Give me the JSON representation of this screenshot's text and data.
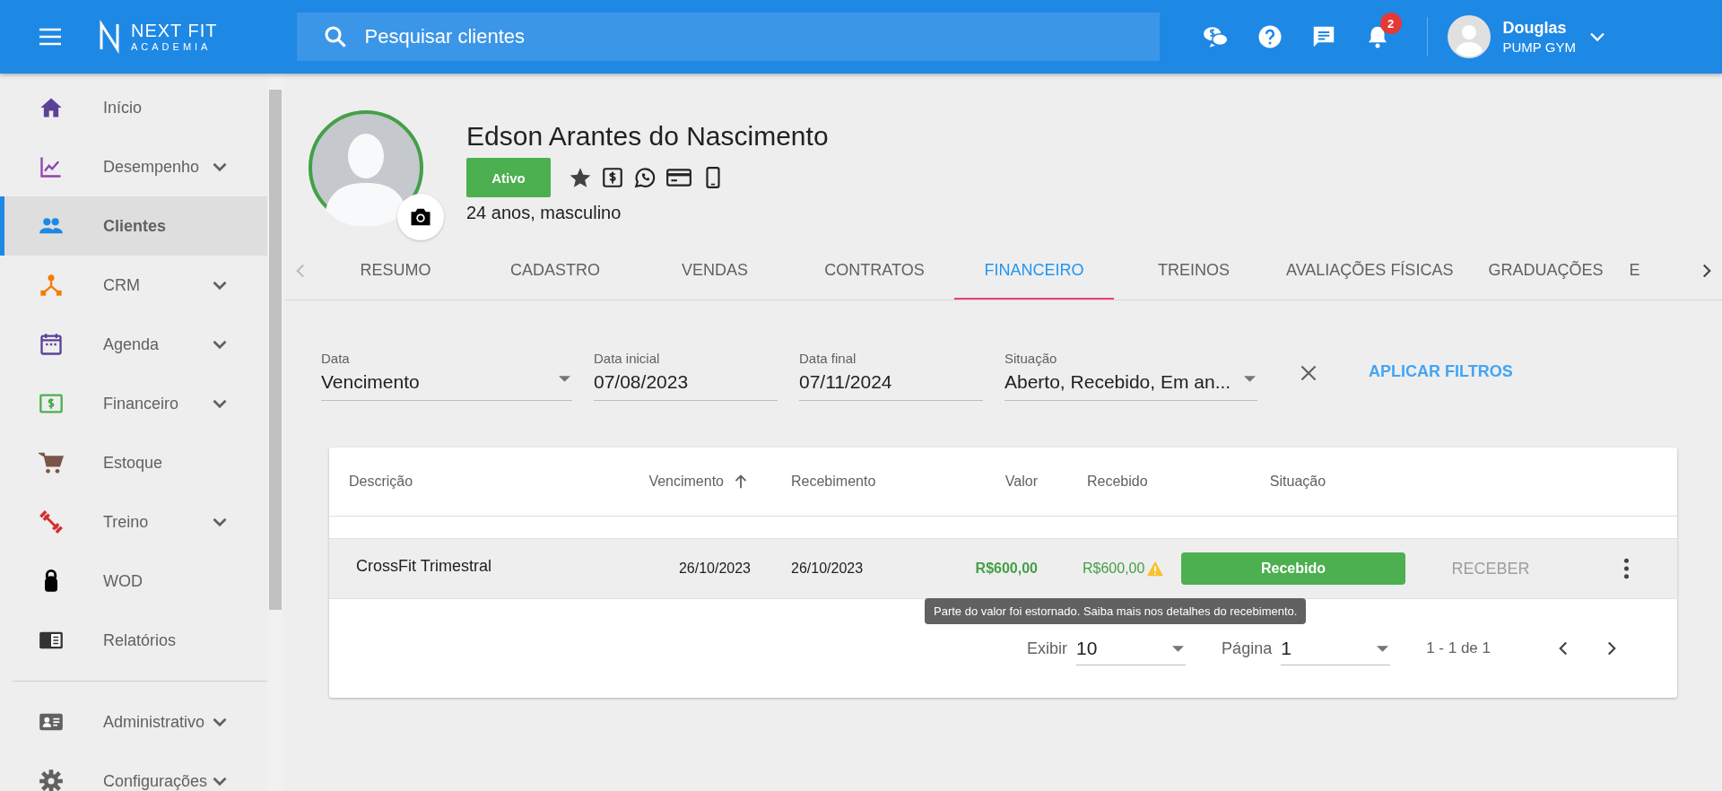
{
  "topbar": {
    "brand": "NEXT FIT",
    "brand_sub": "ACADEMIA",
    "search": {
      "placeholder": "Pesquisar clientes"
    },
    "notifications": "2",
    "user": {
      "name": "Douglas",
      "gym": "PUMP GYM"
    }
  },
  "sidebar": {
    "groups": [
      [
        {
          "label": "Início",
          "expandable": false,
          "selected": false
        },
        {
          "label": "Desempenho",
          "expandable": true,
          "selected": false
        },
        {
          "label": "Clientes",
          "expandable": false,
          "selected": true
        },
        {
          "label": "CRM",
          "expandable": true,
          "selected": false
        },
        {
          "label": "Agenda",
          "expandable": true,
          "selected": false
        },
        {
          "label": "Financeiro",
          "expandable": true,
          "selected": false
        },
        {
          "label": "Estoque",
          "expandable": false,
          "selected": false
        },
        {
          "label": "Treino",
          "expandable": true,
          "selected": false
        },
        {
          "label": "WOD",
          "expandable": false,
          "selected": false
        },
        {
          "label": "Relatórios",
          "expandable": false,
          "selected": false
        }
      ],
      [
        {
          "label": "Administrativo",
          "expandable": true,
          "selected": false
        },
        {
          "label": "Configurações",
          "expandable": true,
          "selected": false
        }
      ]
    ]
  },
  "profile": {
    "name": "Edson Arantes do Nascimento",
    "status": "Ativo",
    "details": "24 anos, masculino"
  },
  "tabs": [
    {
      "label": "RESUMO",
      "selected": false
    },
    {
      "label": "CADASTRO",
      "selected": false
    },
    {
      "label": "VENDAS",
      "selected": false
    },
    {
      "label": "CONTRATOS",
      "selected": false
    },
    {
      "label": "FINANCEIRO",
      "selected": true
    },
    {
      "label": "TREINOS",
      "selected": false
    },
    {
      "label": "AVALIAÇÕES FÍSICAS",
      "selected": false
    },
    {
      "label": "GRADUAÇÕES",
      "selected": false
    },
    {
      "label": "E",
      "selected": false
    }
  ],
  "filters": {
    "fields": [
      {
        "label": "Data",
        "value": "Vencimento",
        "kind": "select"
      },
      {
        "label": "Data inicial",
        "value": "07/08/2023",
        "kind": "text"
      },
      {
        "label": "Data final",
        "value": "07/11/2024",
        "kind": "text"
      },
      {
        "label": "Situação",
        "value": "Aberto, Recebido, Em an...",
        "kind": "select"
      }
    ],
    "apply": "APLICAR FILTROS"
  },
  "table": {
    "columns": [
      {
        "label": "Descrição",
        "sorted": false
      },
      {
        "label": "Vencimento",
        "sorted": true
      },
      {
        "label": "Recebimento",
        "sorted": false
      },
      {
        "label": "Valor",
        "sorted": false
      },
      {
        "label": "Recebido",
        "sorted": false
      },
      {
        "label": "Situação",
        "sorted": false
      }
    ],
    "rows": [
      {
        "description": "CrossFit Trimestral",
        "due": "26/10/2023",
        "received_on": "26/10/2023",
        "value": "R$600,00",
        "received": "R$600,00",
        "warning": true,
        "status": "Recebido",
        "action": "RECEBER"
      }
    ],
    "tooltip": "Parte do valor foi estornado. Saiba mais nos detalhes do recebimento.",
    "pagination": {
      "show_label": "Exibir",
      "show_value": "10",
      "page_label": "Página",
      "page_value": "1",
      "range": "1 - 1 de 1"
    }
  }
}
